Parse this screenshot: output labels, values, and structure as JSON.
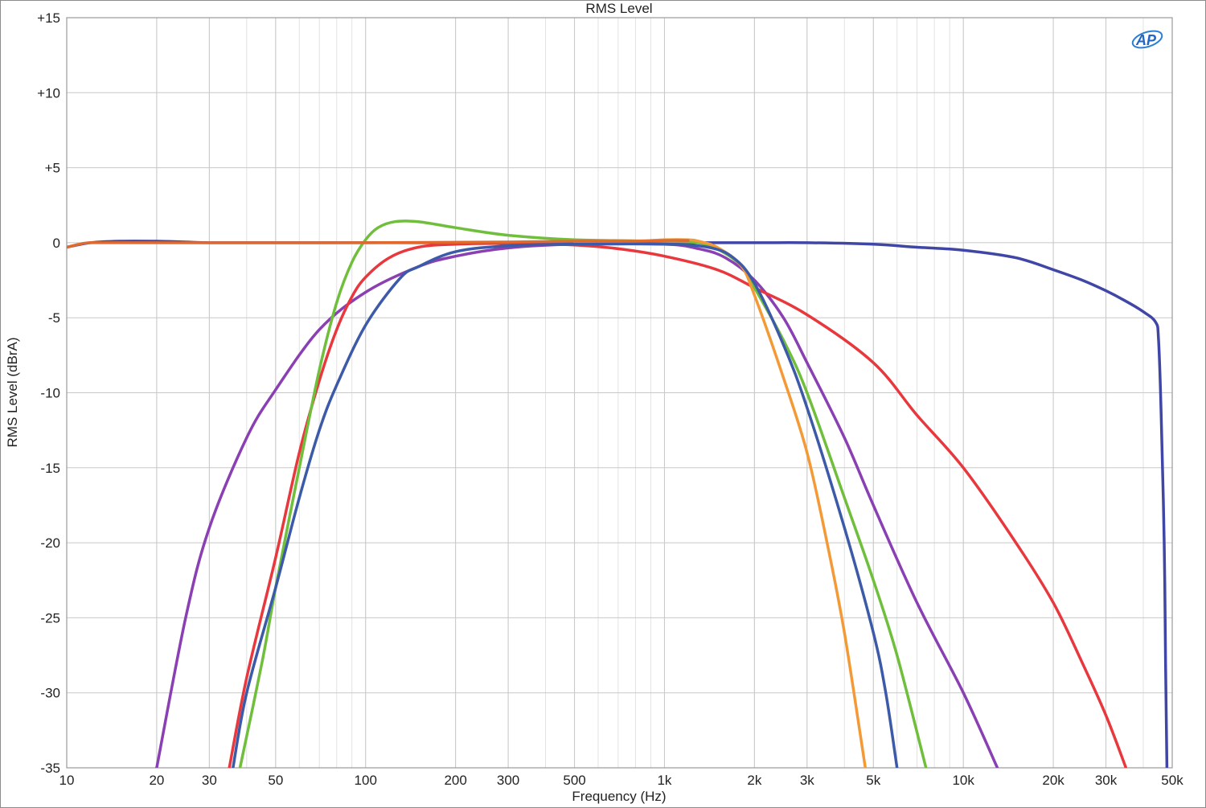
{
  "chart_data": {
    "type": "line",
    "title": "RMS Level",
    "xlabel": "Frequency (Hz)",
    "ylabel": "RMS Level (dBrA)",
    "x_scale": "log",
    "xlim": [
      10,
      50000
    ],
    "ylim": [
      -35,
      15
    ],
    "grid": true,
    "legend": "none",
    "logo": "AP",
    "x_ticks": [
      {
        "value": 10,
        "label": "10"
      },
      {
        "value": 20,
        "label": "20"
      },
      {
        "value": 30,
        "label": "30"
      },
      {
        "value": 50,
        "label": "50"
      },
      {
        "value": 100,
        "label": "100"
      },
      {
        "value": 200,
        "label": "200"
      },
      {
        "value": 300,
        "label": "300"
      },
      {
        "value": 500,
        "label": "500"
      },
      {
        "value": 1000,
        "label": "1k"
      },
      {
        "value": 2000,
        "label": "2k"
      },
      {
        "value": 3000,
        "label": "3k"
      },
      {
        "value": 5000,
        "label": "5k"
      },
      {
        "value": 10000,
        "label": "10k"
      },
      {
        "value": 20000,
        "label": "20k"
      },
      {
        "value": 30000,
        "label": "30k"
      },
      {
        "value": 50000,
        "label": "50k"
      }
    ],
    "y_ticks": [
      {
        "value": 15,
        "label": "+15"
      },
      {
        "value": 10,
        "label": "+10"
      },
      {
        "value": 5,
        "label": "+5"
      },
      {
        "value": 0,
        "label": "0"
      },
      {
        "value": -5,
        "label": "-5"
      },
      {
        "value": -10,
        "label": "-10"
      },
      {
        "value": -15,
        "label": "-15"
      },
      {
        "value": -20,
        "label": "-20"
      },
      {
        "value": -25,
        "label": "-25"
      },
      {
        "value": -30,
        "label": "-30"
      },
      {
        "value": -35,
        "label": "-35"
      }
    ],
    "series": [
      {
        "color": "#3f46a6",
        "points": [
          [
            10,
            -0.3
          ],
          [
            12,
            0
          ],
          [
            15,
            0.1
          ],
          [
            20,
            0.1
          ],
          [
            25,
            0.05
          ],
          [
            30,
            0
          ],
          [
            50,
            0
          ],
          [
            100,
            0
          ],
          [
            500,
            0
          ],
          [
            1000,
            0
          ],
          [
            2000,
            0
          ],
          [
            3000,
            0
          ],
          [
            5000,
            -0.1
          ],
          [
            7000,
            -0.3
          ],
          [
            10000,
            -0.5
          ],
          [
            15000,
            -1.0
          ],
          [
            20000,
            -1.8
          ],
          [
            25000,
            -2.5
          ],
          [
            30000,
            -3.2
          ],
          [
            35000,
            -3.9
          ],
          [
            40000,
            -4.6
          ],
          [
            44000,
            -5.3
          ],
          [
            45000,
            -6.5
          ],
          [
            46000,
            -12
          ],
          [
            47000,
            -20
          ],
          [
            47500,
            -28
          ],
          [
            48000,
            -35
          ]
        ]
      },
      {
        "color": "#8a3fb2",
        "points": [
          [
            20,
            -35
          ],
          [
            25,
            -25
          ],
          [
            30,
            -19
          ],
          [
            40,
            -13
          ],
          [
            50,
            -9.8
          ],
          [
            70,
            -5.8
          ],
          [
            100,
            -3.3
          ],
          [
            150,
            -1.6
          ],
          [
            200,
            -0.9
          ],
          [
            300,
            -0.35
          ],
          [
            500,
            -0.1
          ],
          [
            1000,
            -0.1
          ],
          [
            1300,
            -0.4
          ],
          [
            1600,
            -1.0
          ],
          [
            2000,
            -2.5
          ],
          [
            2500,
            -5
          ],
          [
            3000,
            -8
          ],
          [
            4000,
            -13
          ],
          [
            5000,
            -17.5
          ],
          [
            7000,
            -24
          ],
          [
            10000,
            -30
          ],
          [
            13000,
            -35
          ]
        ]
      },
      {
        "color": "#e8383d",
        "points": [
          [
            35,
            -35
          ],
          [
            40,
            -29
          ],
          [
            50,
            -21
          ],
          [
            60,
            -14
          ],
          [
            70,
            -9.2
          ],
          [
            80,
            -5.8
          ],
          [
            90,
            -3.6
          ],
          [
            100,
            -2.3
          ],
          [
            120,
            -1.0
          ],
          [
            150,
            -0.3
          ],
          [
            200,
            -0.1
          ],
          [
            300,
            -0.05
          ],
          [
            500,
            -0.15
          ],
          [
            700,
            -0.4
          ],
          [
            1000,
            -0.9
          ],
          [
            1500,
            -1.8
          ],
          [
            2000,
            -3.0
          ],
          [
            3000,
            -4.8
          ],
          [
            5000,
            -8
          ],
          [
            7000,
            -11.5
          ],
          [
            10000,
            -15
          ],
          [
            15000,
            -20
          ],
          [
            20000,
            -24
          ],
          [
            25000,
            -28
          ],
          [
            30000,
            -31.5
          ],
          [
            35000,
            -35
          ]
        ]
      },
      {
        "color": "#6fbe3c",
        "points": [
          [
            38,
            -35
          ],
          [
            45,
            -28
          ],
          [
            50,
            -23
          ],
          [
            60,
            -15
          ],
          [
            70,
            -8.5
          ],
          [
            80,
            -4
          ],
          [
            90,
            -1.3
          ],
          [
            100,
            0.2
          ],
          [
            110,
            1.0
          ],
          [
            125,
            1.4
          ],
          [
            150,
            1.4
          ],
          [
            200,
            1.0
          ],
          [
            300,
            0.5
          ],
          [
            500,
            0.2
          ],
          [
            1000,
            0.1
          ],
          [
            1300,
            0
          ],
          [
            1500,
            -0.4
          ],
          [
            1800,
            -1.5
          ],
          [
            2000,
            -3.0
          ],
          [
            2500,
            -6.5
          ],
          [
            3000,
            -10
          ],
          [
            4000,
            -17
          ],
          [
            5000,
            -22.5
          ],
          [
            6000,
            -27.5
          ],
          [
            7500,
            -35
          ]
        ]
      },
      {
        "color": "#f39a37",
        "points": [
          [
            500,
            0
          ],
          [
            800,
            0.1
          ],
          [
            1000,
            0.2
          ],
          [
            1200,
            0.2
          ],
          [
            1300,
            0.1
          ],
          [
            1500,
            -0.3
          ],
          [
            1800,
            -1.5
          ],
          [
            2000,
            -3.5
          ],
          [
            2500,
            -9
          ],
          [
            3000,
            -14
          ],
          [
            3500,
            -20
          ],
          [
            4000,
            -26
          ],
          [
            4700,
            -35
          ]
        ]
      },
      {
        "color": "#3c5aa8",
        "points": [
          [
            36,
            -35
          ],
          [
            40,
            -30
          ],
          [
            50,
            -23
          ],
          [
            60,
            -17
          ],
          [
            70,
            -12.5
          ],
          [
            80,
            -9.5
          ],
          [
            100,
            -5.5
          ],
          [
            130,
            -2.4
          ],
          [
            150,
            -1.6
          ],
          [
            200,
            -0.6
          ],
          [
            300,
            -0.2
          ],
          [
            500,
            -0.1
          ],
          [
            1000,
            -0.1
          ],
          [
            1400,
            -0.3
          ],
          [
            1700,
            -1.0
          ],
          [
            2000,
            -2.7
          ],
          [
            2500,
            -6.8
          ],
          [
            3000,
            -11
          ],
          [
            4000,
            -19
          ],
          [
            5000,
            -26
          ],
          [
            5500,
            -30
          ],
          [
            6000,
            -35
          ]
        ]
      },
      {
        "color": "#e06a2e",
        "points": [
          [
            10,
            -0.3
          ],
          [
            11,
            -0.1
          ],
          [
            12,
            0
          ],
          [
            15,
            0
          ],
          [
            100,
            0
          ],
          [
            300,
            0.05
          ],
          [
            500,
            0.1
          ],
          [
            800,
            0.1
          ],
          [
            1000,
            0.15
          ],
          [
            1200,
            0.15
          ]
        ]
      }
    ]
  }
}
